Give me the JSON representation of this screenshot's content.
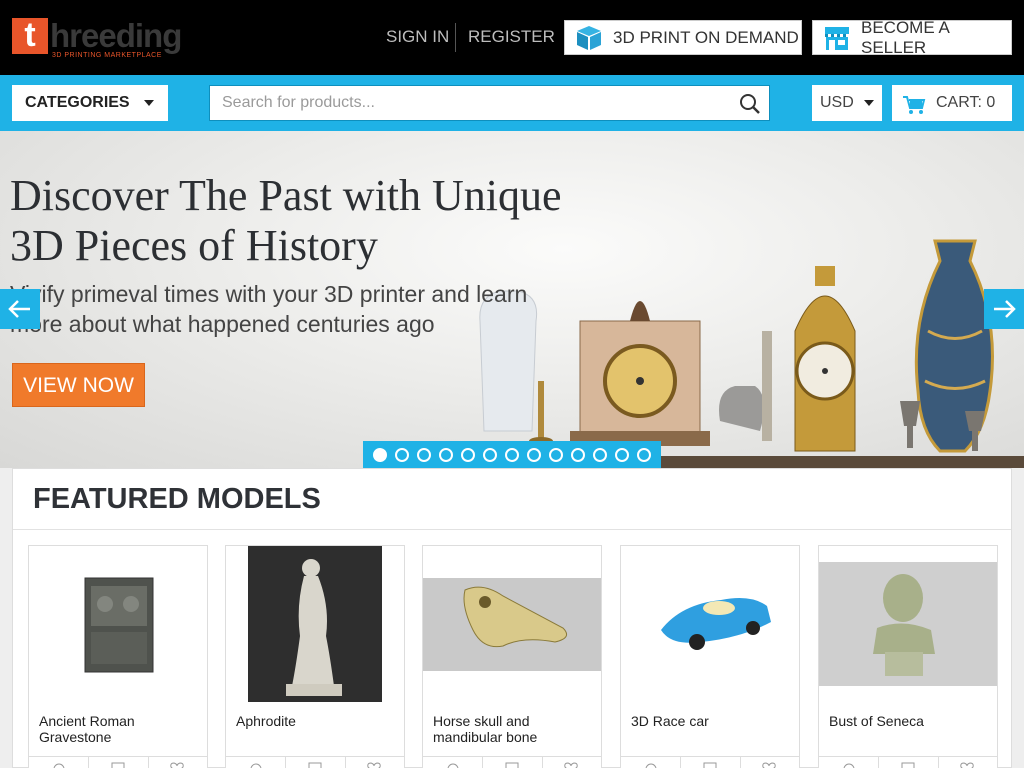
{
  "header": {
    "logo_letter": "t",
    "logo_word": "hreeding",
    "logo_tagline": "3D PRINTING MARKETPLACE",
    "sign_in": "SIGN IN",
    "register": "REGISTER",
    "print_on_demand": "3D PRINT ON DEMAND",
    "become_seller": "BECOME A SELLER"
  },
  "navbar": {
    "categories": "CATEGORIES",
    "search_placeholder": "Search for products...",
    "currency": "USD",
    "cart": "CART: 0"
  },
  "hero": {
    "title": "Discover The Past with Unique 3D Pieces of History",
    "subtitle": "Vivify primeval times with your 3D printer and learn more about what happened centuries ago",
    "cta": "VIEW NOW",
    "slide_count": 13,
    "active_slide": 1
  },
  "featured": {
    "heading": "FEATURED MODELS",
    "products": [
      {
        "name": "Ancient Roman Gravestone",
        "image": "gravestone"
      },
      {
        "name": "Aphrodite",
        "image": "statue"
      },
      {
        "name": "Horse skull and mandibular bone",
        "image": "horse-skull"
      },
      {
        "name": "3D Race car",
        "image": "race-car"
      },
      {
        "name": "Bust of Seneca",
        "image": "bust"
      }
    ]
  },
  "colors": {
    "accent_blue": "#1fb2e6",
    "accent_orange": "#f07a2b",
    "logo_orange": "#e8552a"
  }
}
